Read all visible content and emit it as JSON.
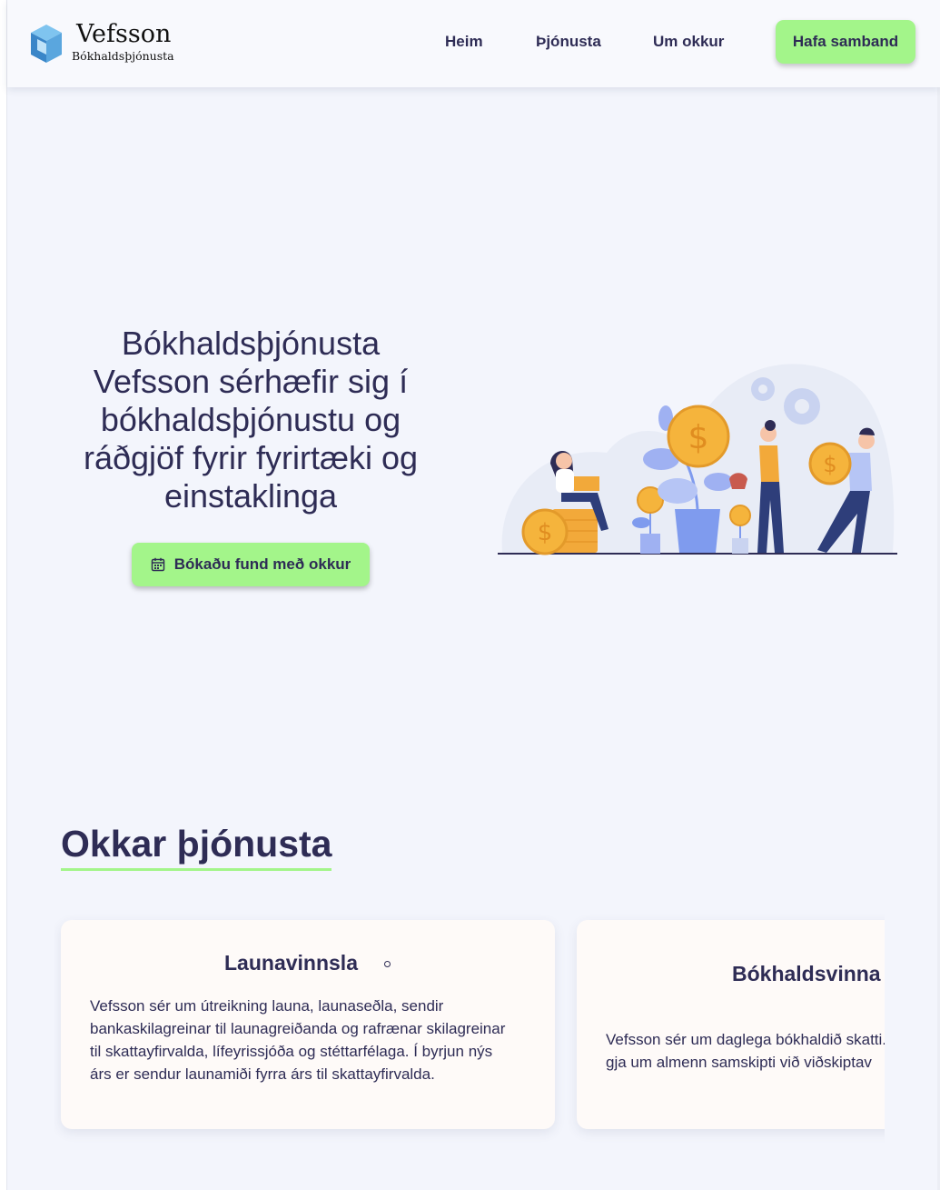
{
  "brand": {
    "name": "Vefsson",
    "subtitle": "Bókhaldsþjónusta"
  },
  "nav": {
    "items": [
      "Heim",
      "Þjónusta",
      "Um okkur"
    ],
    "cta": "Hafa samband"
  },
  "hero": {
    "title": "Bókhaldsþjónusta Vefsson sérhæfir sig í bókhaldsþjónustu og ráðgjöf fyrir fyrirtæki og einstaklinga",
    "button_label": "Bókaðu fund með okkur",
    "button_icon": "calendar-icon",
    "illustration": "people-growing-money-plants-illustration"
  },
  "services": {
    "heading": "Okkar þjónusta",
    "cards": [
      {
        "title": "Launavinnsla",
        "text": "Vefsson sér um útreikning launa, launaseðla, sendir bankaskilagreinar til launagreiðanda og rafrænar skilagreinar til skattayfirvalda, lífeyrissjóða og stéttarfélaga. Í byrjun nýs árs er sendur launamiði fyrra árs til skattayfirvalda."
      },
      {
        "title": "Bókhaldsvinna",
        "text": "Vefsson sér um daglega bókhaldið skatti. Við sendum áminningar á gja um almenn samskipti við viðskiptav"
      }
    ]
  },
  "colors": {
    "accent": "#a3f58a",
    "text": "#2e2c55",
    "background": "#f3f5fc",
    "card": "#fefaf8",
    "coin": "#f5b43c",
    "illustration_blue": "#7f9bee"
  }
}
